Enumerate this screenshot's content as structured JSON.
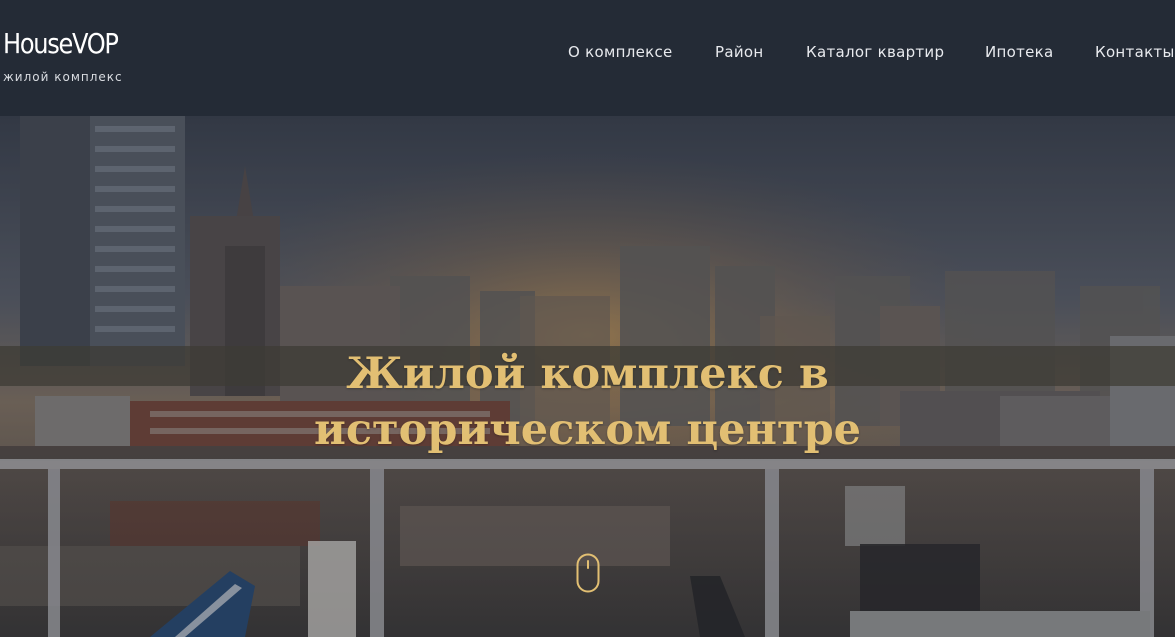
{
  "header": {
    "logo_name": "HouseVOP",
    "logo_subtitle": "жилой комплекс",
    "nav": [
      {
        "label": "О комплексе"
      },
      {
        "label": "Район"
      },
      {
        "label": "Каталог квартир"
      },
      {
        "label": "Ипотека"
      },
      {
        "label": "Контакты"
      }
    ],
    "background_color": "#242b36"
  },
  "hero": {
    "title_line1": "Жилой комплекс в",
    "title_line2": "историческом центре",
    "title_color": "#e2bf73",
    "scroll_indicator_icon": "mouse-scroll-icon"
  }
}
